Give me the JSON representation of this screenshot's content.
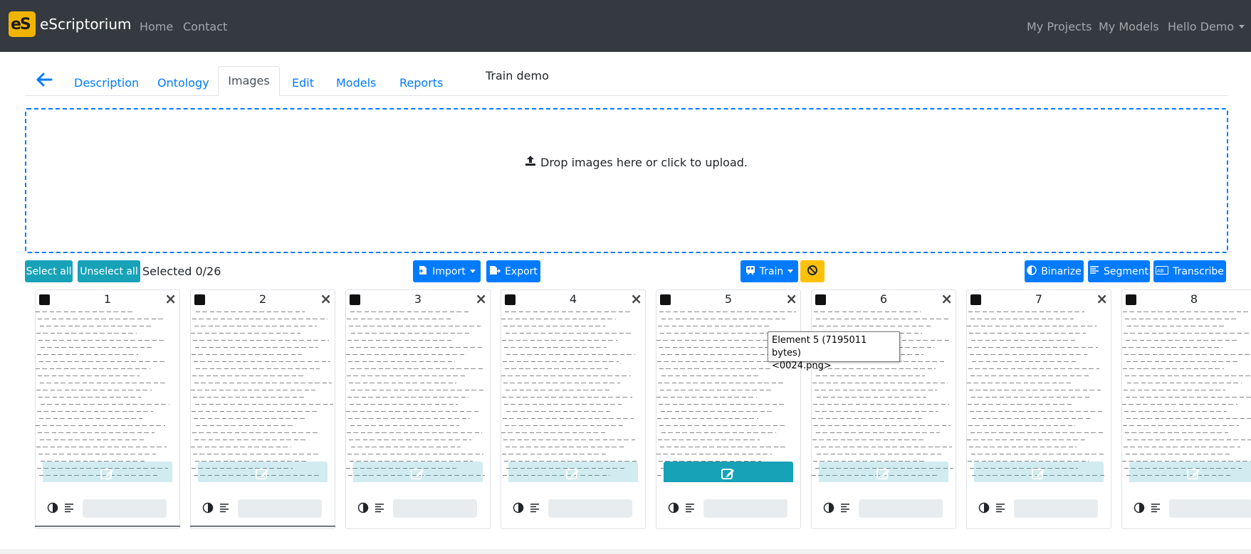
{
  "navbar": {
    "brand": "eScriptorium",
    "logo_text": "eS",
    "links": [
      "Home",
      "Contact"
    ],
    "right_links": [
      "My Projects",
      "My Models"
    ],
    "user_menu": "Hello Demo"
  },
  "tabs": {
    "items": [
      "Description",
      "Ontology",
      "Images",
      "Edit",
      "Models",
      "Reports"
    ],
    "active": "Images",
    "document_title": "Train demo"
  },
  "dropzone": {
    "message": "Drop images here or click to upload."
  },
  "toolbar": {
    "select_all": "Select all",
    "unselect_all": "Unselect all",
    "selected_count": "Selected 0/26",
    "import": "Import",
    "export": "Export",
    "train": "Train",
    "binarize": "Binarize",
    "segment": "Segment",
    "transcribe": "Transcribe"
  },
  "cards": [
    {
      "number": "1"
    },
    {
      "number": "2"
    },
    {
      "number": "3"
    },
    {
      "number": "4"
    },
    {
      "number": "5"
    },
    {
      "number": "6"
    },
    {
      "number": "7"
    },
    {
      "number": "8"
    }
  ],
  "tooltip": {
    "line1": "Element 5 (7195011 bytes)",
    "line2": "<0024.png>"
  },
  "colors": {
    "navbar_bg": "#343a40",
    "primary": "#007bff",
    "info": "#17a2b8",
    "warning": "#ffc107",
    "logo": "#f0b400"
  },
  "icons": [
    "back-arrow-icon",
    "upload-icon",
    "import-icon",
    "export-icon",
    "train-icon",
    "cancel-icon",
    "binarize-icon",
    "segment-icon",
    "transcribe-icon",
    "edit-icon",
    "close-icon",
    "contrast-icon",
    "align-left-icon"
  ]
}
